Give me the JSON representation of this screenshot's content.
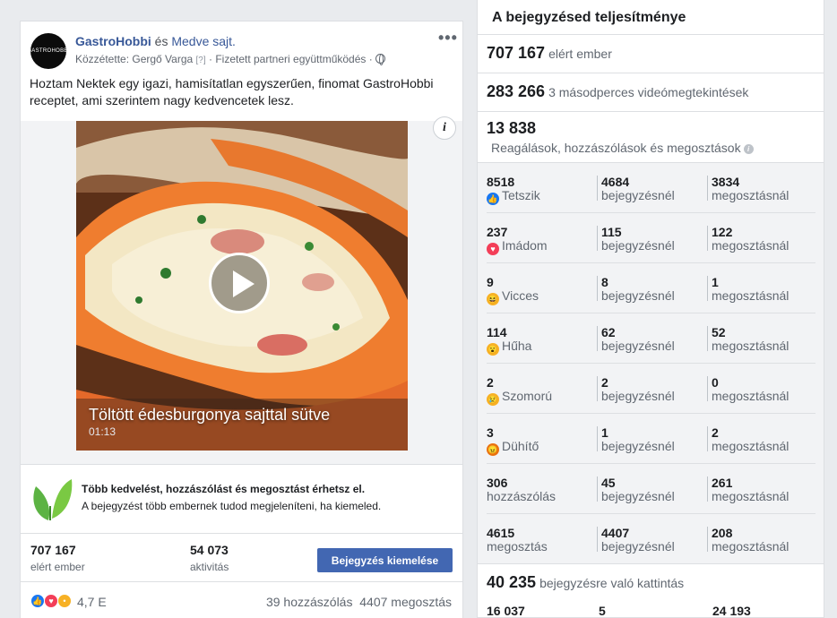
{
  "post": {
    "avatar_text": "GASTROHOBBI",
    "page_name": "GastroHobbi",
    "and_text": " és ",
    "partner_name": "Medve sajt.",
    "published_by": "Közzétette: Gergő Varga",
    "help_mark": "[?]",
    "paid_partnership": " · Fizetett partneri együttműködés · ",
    "more_label": "•••",
    "text": "Hoztam Nektek egy igazi, hamisítatlan egyszerűen, finomat GastroHobbi receptet, ami szerintem nagy kedvencetek lesz.",
    "info_label": "i",
    "video": {
      "title": "Töltött édesburgonya sajttal sütve",
      "duration": "01:13"
    },
    "promo": {
      "title": "Több kedvelést, hozzászólást és megosztást érhetsz el.",
      "subtitle": "A bejegyzést több embernek tudod megjeleníteni, ha kiemeled."
    },
    "stats": {
      "reach_value": "707 167",
      "reach_label": "elért ember",
      "activity_value": "54 073",
      "activity_label": "aktivitás",
      "boost_button": "Bejegyzés kiemelése"
    },
    "reactions": {
      "count": "4,7 E",
      "comments": "39 hozzászólás",
      "shares": "4407 megosztás"
    }
  },
  "panel": {
    "title": "A bejegyzésed teljesítménye",
    "reach_value": "707 167",
    "reach_label": "elért ember",
    "views_value": "283 266",
    "views_label": "3 másodperces videómegtekintések",
    "engagement_value": "13 838",
    "engagement_label": "Reagálások, hozzászólások és megosztások",
    "rows": [
      {
        "total": "8518",
        "label": "Tetszik",
        "icon": "like-icon",
        "color": "#1877f2",
        "post": "4684",
        "post_label": "bejegyzésnél",
        "shared": "3834",
        "shared_label": "megosztásnál"
      },
      {
        "total": "237",
        "label": "Imádom",
        "icon": "love-icon",
        "color": "#f33e58",
        "post": "115",
        "post_label": "bejegyzésnél",
        "shared": "122",
        "shared_label": "megosztásnál"
      },
      {
        "total": "9",
        "label": "Vicces",
        "icon": "haha-icon",
        "color": "#f7b125",
        "post": "8",
        "post_label": "bejegyzésnél",
        "shared": "1",
        "shared_label": "megosztásnál"
      },
      {
        "total": "114",
        "label": "Hűha",
        "icon": "wow-icon",
        "color": "#f7b125",
        "post": "62",
        "post_label": "bejegyzésnél",
        "shared": "52",
        "shared_label": "megosztásnál"
      },
      {
        "total": "2",
        "label": "Szomorú",
        "icon": "sad-icon",
        "color": "#f7b125",
        "post": "2",
        "post_label": "bejegyzésnél",
        "shared": "0",
        "shared_label": "megosztásnál"
      },
      {
        "total": "3",
        "label": "Dühítő",
        "icon": "angry-icon",
        "color": "#e9710f",
        "post": "1",
        "post_label": "bejegyzésnél",
        "shared": "2",
        "shared_label": "megosztásnál"
      },
      {
        "total": "306",
        "label": "hozzászólás",
        "icon": "",
        "color": "",
        "post": "45",
        "post_label": "bejegyzésnél",
        "shared": "261",
        "shared_label": "megosztásnál"
      },
      {
        "total": "4615",
        "label": "megosztás",
        "icon": "",
        "color": "",
        "post": "4407",
        "post_label": "bejegyzésnél",
        "shared": "208",
        "shared_label": "megosztásnál"
      }
    ],
    "clicks_value": "40 235",
    "clicks_label": "bejegyzésre való kattintás",
    "bottom_values": [
      "16 037",
      "5",
      "24 193"
    ]
  }
}
